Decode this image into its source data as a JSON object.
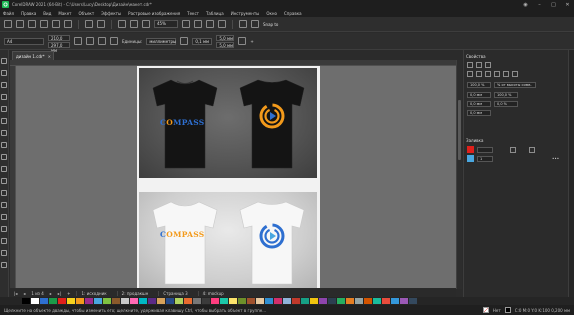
{
  "window": {
    "title": "CorelDRAW 2021 (64-Bit) - C:\\Users\\Lucy\\Desktop\\Дизайн\\макет.cdr*"
  },
  "menu": [
    "Файл",
    "Правка",
    "Вид",
    "Макет",
    "Объект",
    "Эффекты",
    "Растровые изображения",
    "Текст",
    "Таблица",
    "Инструменты",
    "Окно",
    "Справка"
  ],
  "toolbar": {
    "zoom": "45%",
    "snap_label": "Snap to"
  },
  "property_bar": {
    "preset": "A4",
    "width": "210,0 мм",
    "height": "297,0 мм",
    "units_label": "Единицы:",
    "units_value": "миллиметры",
    "nudge": "0,1 мм",
    "dup_x": "5,0 мм",
    "dup_y": "5,0 мм"
  },
  "document": {
    "tab_label": "дизайн 1.cdr*"
  },
  "artwork": {
    "brand_text_a": "C",
    "brand_text_o": "O",
    "brand_text_b": "MPASS",
    "colors": {
      "blue": "#2e6fd0",
      "orange": "#f39a1b",
      "black_shirt": "#141414",
      "white_shirt": "#f7f7f7"
    }
  },
  "page_nav": {
    "page_counter": "1 из 4",
    "tabs": [
      "1: исходник",
      "2: продакшн",
      "Страница 3",
      "4: mockup"
    ]
  },
  "panel": {
    "title": "Свойства",
    "width": "100,0 %",
    "scale_mode": "% от высоты симв.",
    "pos1": "0,0 мм",
    "pos2": "0,0 мм",
    "pos3": "0,0 мм",
    "pct1": "100,0 %",
    "pct2": "0,0 %",
    "fill_head": "Заливка",
    "fill_value": "1"
  },
  "status": {
    "text": "Щелкните на объекте дважды, чтобы изменить его; щелкните, удерживая клавишу Ctrl, чтобы выбрать объект в группе...",
    "fill_label": "Нет",
    "coords": "C:0 M:0 Y:0 K:100 0,200 мм"
  },
  "palette": [
    "#000000",
    "#ffffff",
    "#2e6fd0",
    "#1b9a48",
    "#e0201b",
    "#f6d21f",
    "#f39a1b",
    "#9c2a8b",
    "#4aa7e0",
    "#7fc241",
    "#8b5a2b",
    "#c8c8c8",
    "#ff69b4",
    "#00b7c3",
    "#5b2a86",
    "#d6a25c",
    "#274b8a",
    "#b0d35f",
    "#e86b2f",
    "#777777",
    "#3b3b3b",
    "#ff3d7f",
    "#1cc7a8",
    "#fce36b",
    "#6d8f2a",
    "#a0522d",
    "#e7c9a0",
    "#2f8ed1",
    "#d22f6b",
    "#8fb3d9",
    "#c0392b",
    "#16a085",
    "#f1c40f",
    "#8e44ad",
    "#2c3e50",
    "#27ae60",
    "#e67e22",
    "#95a5a6",
    "#d35400",
    "#1abc9c",
    "#e74c3c",
    "#3498db",
    "#9b59b6",
    "#34495e"
  ]
}
